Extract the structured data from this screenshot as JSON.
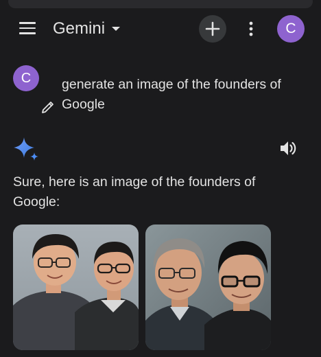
{
  "app": {
    "title": "Gemini",
    "avatar_initial": "C"
  },
  "icons": {
    "menu": "menu-icon",
    "dropdown": "chevron-down-icon",
    "new_chat": "plus-icon",
    "more": "more-vert-icon",
    "edit": "pencil-icon",
    "gemini": "gemini-sparkle-icon",
    "speaker": "volume-icon"
  },
  "conversation": {
    "user": {
      "avatar_initial": "C",
      "message": "generate an image of the founders of Google"
    },
    "assistant": {
      "text": "Sure, here is an image of the founders of Google:",
      "images": [
        {
          "name": "generated-image-1"
        },
        {
          "name": "generated-image-2"
        }
      ]
    }
  },
  "colors": {
    "background": "#1b1b1d",
    "avatar": "#8e63cf",
    "text": "#e3e3e3",
    "button_bg": "#37393b",
    "gemini_blue": "#4c8df6"
  }
}
